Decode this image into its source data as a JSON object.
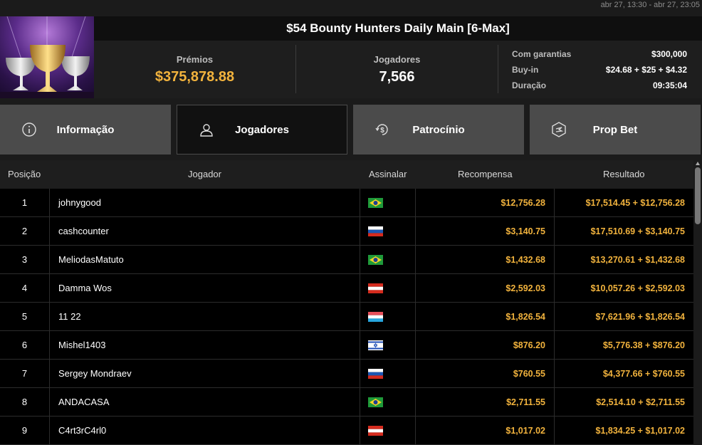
{
  "dates": "abr 27, 13:30 - abr 27, 23:05",
  "title": "$54 Bounty Hunters Daily Main [6-Max]",
  "stats": {
    "prizes_label": "Prémios",
    "prizes_value": "$375,878.88",
    "players_label": "Jogadores",
    "players_value": "7,566"
  },
  "details": [
    {
      "k": "Com garantias",
      "v": "$300,000"
    },
    {
      "k": "Buy-in",
      "v": "$24.68 + $25 + $4.32"
    },
    {
      "k": "Duração",
      "v": "09:35:04"
    }
  ],
  "tabs": [
    {
      "label": "Informação",
      "icon": "info-icon"
    },
    {
      "label": "Jogadores",
      "icon": "user-icon"
    },
    {
      "label": "Patrocínio",
      "icon": "dollar-coin-icon"
    },
    {
      "label": "Prop Bet",
      "icon": "prop-bet-icon"
    }
  ],
  "columns": {
    "position": "Posição",
    "player": "Jogador",
    "flag": "Assinalar",
    "reward": "Recompensa",
    "result": "Resultado"
  },
  "rows": [
    {
      "pos": "1",
      "player": "johnygood",
      "flag": "brazil",
      "reward": "$12,756.28",
      "result": "$17,514.45 + $12,756.28"
    },
    {
      "pos": "2",
      "player": "cashcounter",
      "flag": "russia",
      "reward": "$3,140.75",
      "result": "$17,510.69 + $3,140.75"
    },
    {
      "pos": "3",
      "player": "MeliodasMatuto",
      "flag": "brazil",
      "reward": "$1,432.68",
      "result": "$13,270.61 + $1,432.68"
    },
    {
      "pos": "4",
      "player": "Damma Wos",
      "flag": "austria",
      "reward": "$2,592.03",
      "result": "$10,057.26 + $2,592.03"
    },
    {
      "pos": "5",
      "player": "11 22",
      "flag": "luxembourg",
      "reward": "$1,826.54",
      "result": "$7,621.96 + $1,826.54"
    },
    {
      "pos": "6",
      "player": "Mishel1403",
      "flag": "israel",
      "reward": "$876.20",
      "result": "$5,776.38 + $876.20"
    },
    {
      "pos": "7",
      "player": "Sergey Mondraev",
      "flag": "russia",
      "reward": "$760.55",
      "result": "$4,377.66 + $760.55"
    },
    {
      "pos": "8",
      "player": "ANDACASA",
      "flag": "brazil",
      "reward": "$2,711.55",
      "result": "$2,514.10 + $2,711.55"
    },
    {
      "pos": "9",
      "player": "C4rt3rC4rl0",
      "flag": "austria",
      "reward": "$1,017.02",
      "result": "$1,834.25 + $1,017.02"
    }
  ]
}
